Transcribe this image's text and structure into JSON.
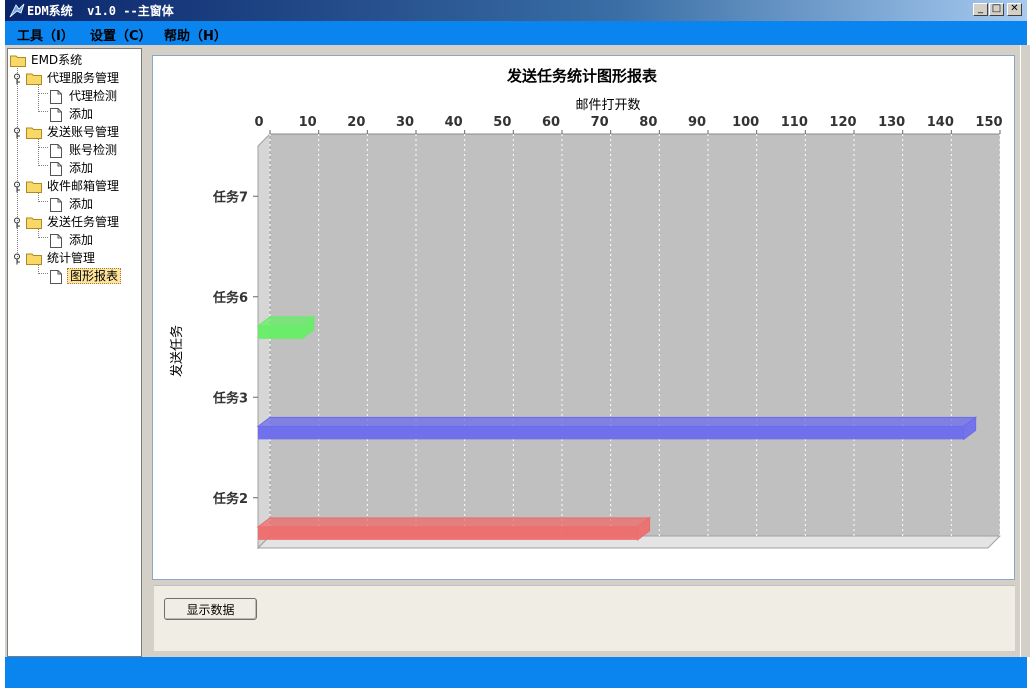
{
  "window": {
    "title": "EDM系统  v1.0 --主窗体",
    "controls": {
      "minimize": "_",
      "maximize": "□",
      "close": "✕"
    }
  },
  "menu": [
    {
      "label": "工具（I）"
    },
    {
      "label": "设置（C）"
    },
    {
      "label": "帮助（H）"
    }
  ],
  "tree": {
    "root": "EMD系统",
    "groups": [
      {
        "label": "代理服务管理",
        "children": [
          "代理检测",
          "添加"
        ]
      },
      {
        "label": "发送账号管理",
        "children": [
          "账号检测",
          "添加"
        ]
      },
      {
        "label": "收件邮箱管理",
        "children": [
          "添加"
        ]
      },
      {
        "label": "发送任务管理",
        "children": [
          "添加"
        ]
      },
      {
        "label": "统计管理",
        "children": [
          "图形报表"
        ]
      }
    ],
    "selected": "图形报表"
  },
  "actions": {
    "show_data_label": "显示数据"
  },
  "chart_data": {
    "type": "bar",
    "orientation": "horizontal-3d",
    "title": "发送任务统计图形报表",
    "xlabel": "邮件打开数",
    "ylabel": "发送任务",
    "xlim": [
      0,
      150
    ],
    "xticks": [
      0,
      10,
      20,
      30,
      40,
      50,
      60,
      70,
      80,
      90,
      100,
      110,
      120,
      130,
      140,
      150
    ],
    "grid": true,
    "categories": [
      "任务7",
      "任务6",
      "任务3",
      "任务2"
    ],
    "values": [
      0,
      9,
      145,
      78
    ],
    "colors": [
      "#888888",
      "#66ee66",
      "#6b6bee",
      "#ee6b6b"
    ]
  }
}
